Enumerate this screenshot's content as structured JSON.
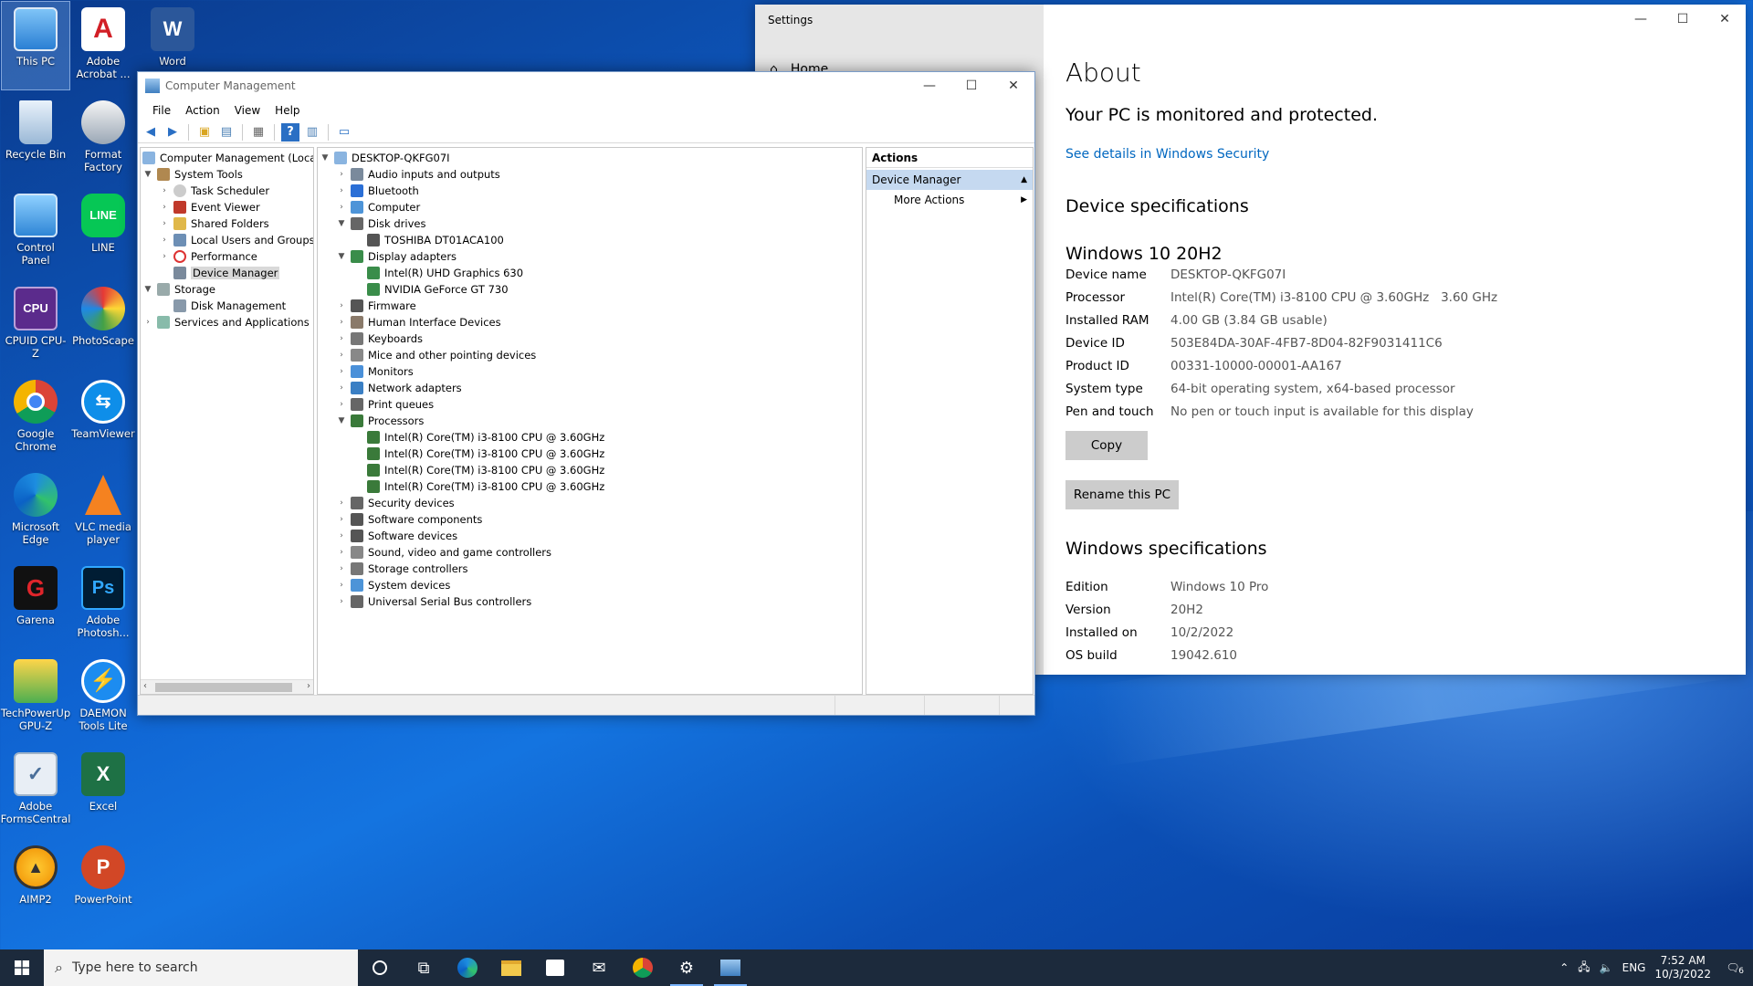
{
  "desktop": {
    "icons": [
      {
        "label": "This PC"
      },
      {
        "label": "Adobe Acrobat ..."
      },
      {
        "label": "Word"
      },
      {
        "label": "Recycle Bin"
      },
      {
        "label": "Format Factory"
      },
      {
        "label": "Control Panel"
      },
      {
        "label": "LINE"
      },
      {
        "label": "CPUID CPU-Z"
      },
      {
        "label": "PhotoScape"
      },
      {
        "label": "Google Chrome"
      },
      {
        "label": "TeamViewer"
      },
      {
        "label": "Microsoft Edge"
      },
      {
        "label": "VLC media player"
      },
      {
        "label": "Garena"
      },
      {
        "label": "Adobe Photosh..."
      },
      {
        "label": "TechPowerUp GPU-Z"
      },
      {
        "label": "DAEMON Tools Lite"
      },
      {
        "label": "Adobe FormsCentral"
      },
      {
        "label": "Excel"
      },
      {
        "label": "AIMP2"
      },
      {
        "label": "PowerPoint"
      }
    ]
  },
  "settings": {
    "title": "Settings",
    "home": "Home",
    "about_title": "About",
    "protected": "Your PC is monitored and protected.",
    "security_link": "See details in Windows Security",
    "device_specs_heading": "Device specifications",
    "device_edition_heading": "Windows 10 20H2",
    "device_specs": [
      {
        "k": "Device name",
        "v": "DESKTOP-QKFG07I"
      },
      {
        "k": "Processor",
        "v": "Intel(R) Core(TM) i3-8100 CPU @ 3.60GHz   3.60 GHz"
      },
      {
        "k": "Installed RAM",
        "v": "4.00 GB (3.84 GB usable)"
      },
      {
        "k": "Device ID",
        "v": "503E84DA-30AF-4FB7-8D04-82F9031411C6"
      },
      {
        "k": "Product ID",
        "v": "00331-10000-00001-AA167"
      },
      {
        "k": "System type",
        "v": "64-bit operating system, x64-based processor"
      },
      {
        "k": "Pen and touch",
        "v": "No pen or touch input is available for this display"
      }
    ],
    "copy_label": "Copy",
    "rename_label": "Rename this PC",
    "windows_specs_heading": "Windows specifications",
    "windows_specs": [
      {
        "k": "Edition",
        "v": "Windows 10 Pro"
      },
      {
        "k": "Version",
        "v": "20H2"
      },
      {
        "k": "Installed on",
        "v": "10/2/2022"
      },
      {
        "k": "OS build",
        "v": "19042.610"
      }
    ]
  },
  "compmgmt": {
    "title": "Computer Management",
    "menu": [
      "File",
      "Action",
      "View",
      "Help"
    ],
    "left_tree": {
      "root": "Computer Management (Local",
      "system_tools": "System Tools",
      "task_scheduler": "Task Scheduler",
      "event_viewer": "Event Viewer",
      "shared_folders": "Shared Folders",
      "local_users": "Local Users and Groups",
      "performance": "Performance",
      "device_manager": "Device Manager",
      "storage": "Storage",
      "disk_management": "Disk Management",
      "services": "Services and Applications"
    },
    "device_tree": {
      "root": "DESKTOP-QKFG07I",
      "nodes": [
        "Audio inputs and outputs",
        "Bluetooth",
        "Computer",
        "Disk drives",
        "TOSHIBA DT01ACA100",
        "Display adapters",
        "Intel(R) UHD Graphics 630",
        "NVIDIA GeForce GT 730",
        "Firmware",
        "Human Interface Devices",
        "Keyboards",
        "Mice and other pointing devices",
        "Monitors",
        "Network adapters",
        "Print queues",
        "Processors",
        "Intel(R) Core(TM) i3-8100 CPU @ 3.60GHz",
        "Intel(R) Core(TM) i3-8100 CPU @ 3.60GHz",
        "Intel(R) Core(TM) i3-8100 CPU @ 3.60GHz",
        "Intel(R) Core(TM) i3-8100 CPU @ 3.60GHz",
        "Security devices",
        "Software components",
        "Software devices",
        "Sound, video and game controllers",
        "Storage controllers",
        "System devices",
        "Universal Serial Bus controllers"
      ]
    },
    "actions": {
      "heading": "Actions",
      "group": "Device Manager",
      "more": "More Actions"
    }
  },
  "taskbar": {
    "search_placeholder": "Type here to search",
    "lang": "ENG",
    "time": "7:52 AM",
    "date": "10/3/2022",
    "notif_count": "6"
  },
  "colors": {
    "accent_link": "#0067c0",
    "selection": "#c5d9f0",
    "taskbar": "#1c2a3c"
  }
}
